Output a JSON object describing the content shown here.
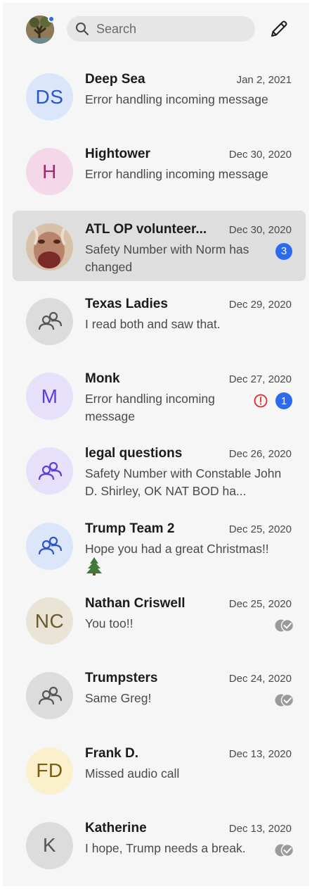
{
  "header": {
    "search_placeholder": "Search",
    "compose_icon": "pencil-icon",
    "profile_badge_color": "#2c6bed"
  },
  "colors": {
    "accent": "#2c6bed",
    "error": "#d92b2b",
    "selected_row": "#dedede"
  },
  "conversations": [
    {
      "name": "Deep Sea",
      "date": "Jan 2, 2021",
      "preview": "Error handling incoming message",
      "avatar_type": "initials",
      "initials": "DS",
      "avatar_bg": "#dbe6fb",
      "avatar_fg": "#2c55c8"
    },
    {
      "name": "Hightower",
      "date": "Dec 30, 2020",
      "preview": "Error handling incoming message",
      "avatar_type": "initials",
      "initials": "H",
      "avatar_bg": "#f4d8ea",
      "avatar_fg": "#a3286f"
    },
    {
      "name": "ATL OP volunteer...",
      "date": "Dec 30, 2020",
      "preview": "Safety Number with Norm has changed",
      "avatar_type": "photo",
      "unread_count": "3",
      "selected": true
    },
    {
      "name": "Texas Ladies",
      "date": "Dec 29, 2020",
      "preview": "I read both and saw that.",
      "avatar_type": "group",
      "avatar_bg": "#dcdcdc",
      "avatar_fg": "#555555"
    },
    {
      "name": "Monk",
      "date": "Dec 27, 2020",
      "preview": "Error handling incoming message",
      "avatar_type": "initials",
      "initials": "M",
      "avatar_bg": "#e6e0fb",
      "avatar_fg": "#5a3fd8",
      "unread_count": "1",
      "error_icon": "alert-circle-icon"
    },
    {
      "name": "legal questions",
      "date": "Dec 26, 2020",
      "preview": "Safety Number with Constable John D. Shirley, OK NAT BOD ha...",
      "avatar_type": "group",
      "avatar_bg": "#e6e0fb",
      "avatar_fg": "#5a3fd8"
    },
    {
      "name": "Trump Team 2",
      "date": "Dec 25, 2020",
      "preview": "Hope you had a great Christmas!!",
      "preview_emoji": "christmas-tree-icon",
      "avatar_type": "group",
      "avatar_bg": "#dbe6fb",
      "avatar_fg": "#2c55c8"
    },
    {
      "name": "Nathan Criswell",
      "date": "Dec 25, 2020",
      "preview": "You too!!",
      "avatar_type": "initials",
      "initials": "NC",
      "avatar_bg": "#e9e4d6",
      "avatar_fg": "#6b5a2e",
      "status_icon": "read-check-icon"
    },
    {
      "name": "Trumpsters",
      "date": "Dec 24, 2020",
      "preview": "Same Greg!",
      "avatar_type": "group",
      "avatar_bg": "#dcdcdc",
      "avatar_fg": "#555555",
      "status_icon": "read-check-icon"
    },
    {
      "name": "Frank D.",
      "date": "Dec 13, 2020",
      "preview": "Missed audio call",
      "avatar_type": "initials",
      "initials": "FD",
      "avatar_bg": "#fbf0cc",
      "avatar_fg": "#7a5c12"
    },
    {
      "name": "Katherine",
      "date": "Dec 13, 2020",
      "preview": "I hope, Trump needs a break.",
      "avatar_type": "initials",
      "initials": "K",
      "avatar_bg": "#dcdcdc",
      "avatar_fg": "#555555",
      "status_icon": "read-check-icon"
    }
  ]
}
